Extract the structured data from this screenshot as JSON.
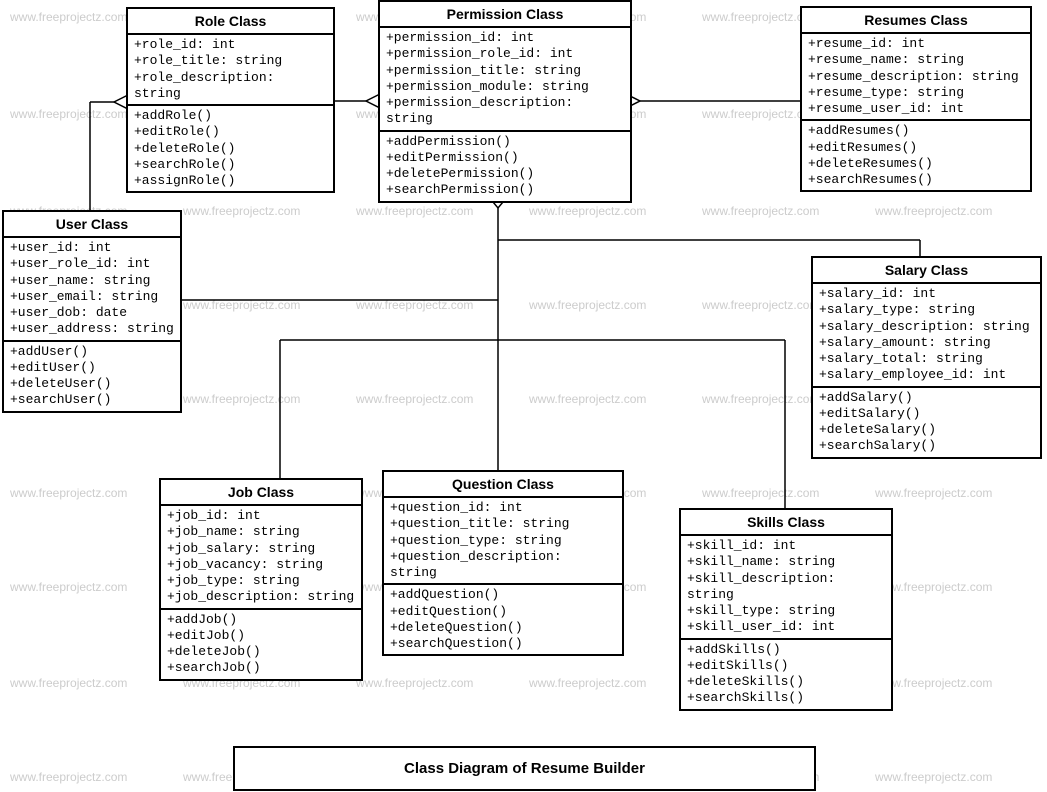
{
  "watermark": "www.freeprojectz.com",
  "diagram_title": "Class Diagram of Resume Builder",
  "classes": {
    "role": {
      "name": "Role Class",
      "attrs": [
        "+role_id: int",
        "+role_title: string",
        "+role_description: string"
      ],
      "methods": [
        "+addRole()",
        "+editRole()",
        "+deleteRole()",
        "+searchRole()",
        "+assignRole()"
      ]
    },
    "permission": {
      "name": "Permission Class",
      "attrs": [
        "+permission_id: int",
        "+permission_role_id: int",
        "+permission_title: string",
        "+permission_module: string",
        "+permission_description: string"
      ],
      "methods": [
        "+addPermission()",
        "+editPermission()",
        "+deletePermission()",
        "+searchPermission()"
      ]
    },
    "resumes": {
      "name": "Resumes Class",
      "attrs": [
        "+resume_id: int",
        "+resume_name: string",
        "+resume_description: string",
        "+resume_type: string",
        "+resume_user_id: int"
      ],
      "methods": [
        "+addResumes()",
        "+editResumes()",
        "+deleteResumes()",
        "+searchResumes()"
      ]
    },
    "user": {
      "name": "User Class",
      "attrs": [
        "+user_id: int",
        "+user_role_id: int",
        "+user_name: string",
        "+user_email: string",
        "+user_dob: date",
        "+user_address: string"
      ],
      "methods": [
        "+addUser()",
        "+editUser()",
        "+deleteUser()",
        "+searchUser()"
      ]
    },
    "salary": {
      "name": "Salary Class",
      "attrs": [
        "+salary_id: int",
        "+salary_type: string",
        "+salary_description: string",
        "+salary_amount: string",
        "+salary_total: string",
        "+salary_employee_id: int"
      ],
      "methods": [
        "+addSalary()",
        "+editSalary()",
        "+deleteSalary()",
        "+searchSalary()"
      ]
    },
    "job": {
      "name": "Job Class",
      "attrs": [
        "+job_id: int",
        "+job_name: string",
        "+job_salary: string",
        "+job_vacancy: string",
        "+job_type: string",
        "+job_description: string"
      ],
      "methods": [
        "+addJob()",
        "+editJob()",
        "+deleteJob()",
        "+searchJob()"
      ]
    },
    "question": {
      "name": "Question  Class",
      "attrs": [
        "+question_id: int",
        "+question_title: string",
        "+question_type: string",
        "+question_description: string"
      ],
      "methods": [
        "+addQuestion()",
        "+editQuestion()",
        "+deleteQuestion()",
        "+searchQuestion()"
      ]
    },
    "skills": {
      "name": "Skills Class",
      "attrs": [
        "+skill_id: int",
        "+skill_name: string",
        "+skill_description: string",
        "+skill_type: string",
        "+skill_user_id: int"
      ],
      "methods": [
        "+addSkills()",
        "+editSkills()",
        "+deleteSkills()",
        "+searchSkills()"
      ]
    }
  },
  "chart_data": {
    "type": "class-diagram",
    "classes": [
      "Role Class",
      "Permission Class",
      "Resumes Class",
      "User Class",
      "Salary Class",
      "Job Class",
      "Question  Class",
      "Skills Class"
    ],
    "relationships": [
      {
        "from": "Permission Class",
        "to": "Role Class",
        "type": "aggregation"
      },
      {
        "from": "Permission Class",
        "to": "Resumes Class",
        "type": "aggregation"
      },
      {
        "from": "Role Class",
        "to": "User Class",
        "type": "aggregation"
      },
      {
        "from": "Permission Class",
        "to": "Job Class",
        "type": "aggregation"
      },
      {
        "from": "Permission Class",
        "to": "Question  Class",
        "type": "aggregation"
      },
      {
        "from": "Permission Class",
        "to": "Salary Class",
        "type": "aggregation"
      },
      {
        "from": "Permission Class",
        "to": "Skills Class",
        "type": "aggregation"
      }
    ]
  }
}
